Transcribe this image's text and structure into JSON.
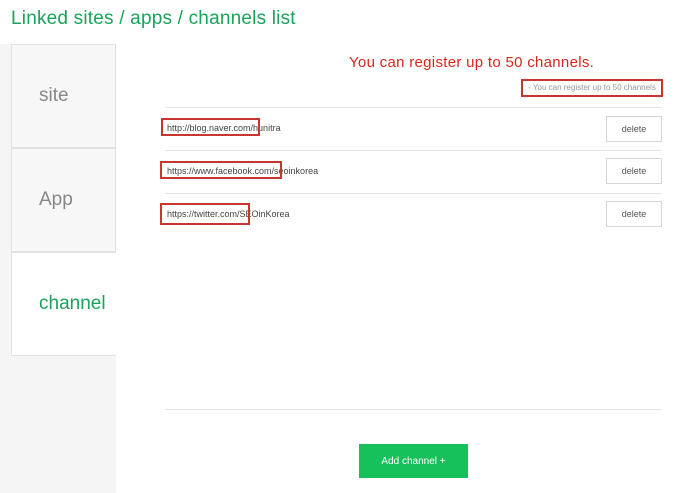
{
  "header": {
    "title": "Linked sites / apps / channels list"
  },
  "sidebar": {
    "items": [
      {
        "label": "site"
      },
      {
        "label": "App"
      },
      {
        "label": "channel"
      }
    ]
  },
  "main": {
    "annotation": "You can register up to 50 channels.",
    "limit_note": "- You can register up to 50 channels",
    "channels": [
      {
        "url": "http://blog.naver.com/hunitra",
        "delete_label": "delete"
      },
      {
        "url": "https://www.facebook.com/seoinkorea",
        "delete_label": "delete"
      },
      {
        "url": "https://twitter.com/SEOinKorea",
        "delete_label": "delete"
      }
    ],
    "add_button_label": "Add channel +"
  },
  "colors": {
    "accent_green": "#1aa35a",
    "button_green": "#16c05a",
    "highlight_red": "#c8372d"
  }
}
